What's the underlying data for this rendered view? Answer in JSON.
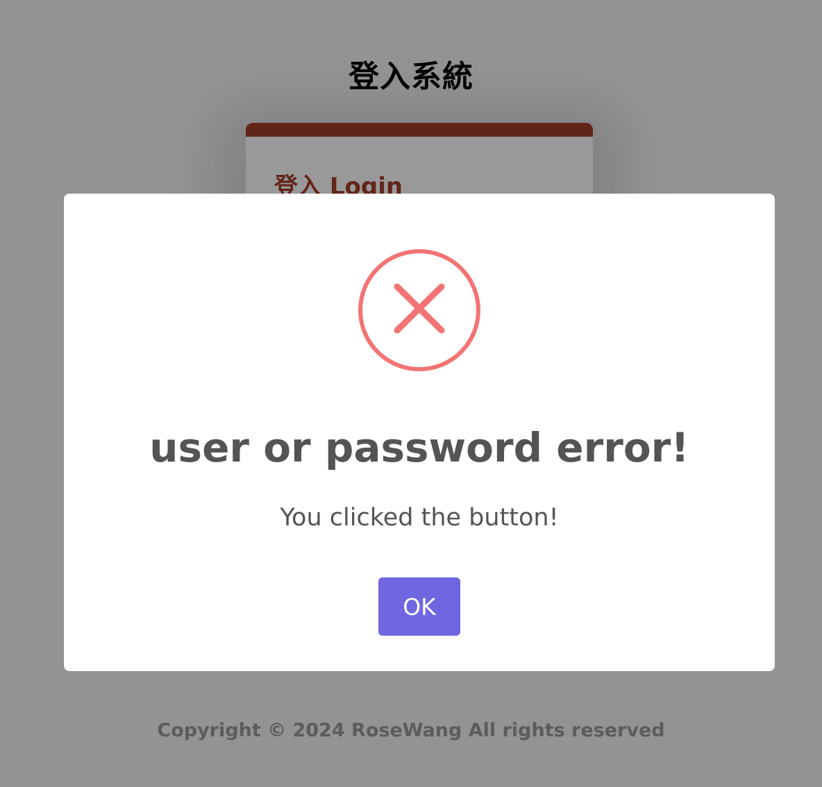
{
  "page": {
    "title": "登入系統",
    "login_heading": "登入 Login",
    "footer": "Copyright © 2024 RoseWang All rights reserved",
    "accent_color": "#a33e2a"
  },
  "modal": {
    "icon": "error-x-circle-icon",
    "icon_color": "#f27474",
    "title": "user or password error!",
    "text": "You clicked the button!",
    "ok_label": "OK",
    "button_color": "#7066e0"
  }
}
